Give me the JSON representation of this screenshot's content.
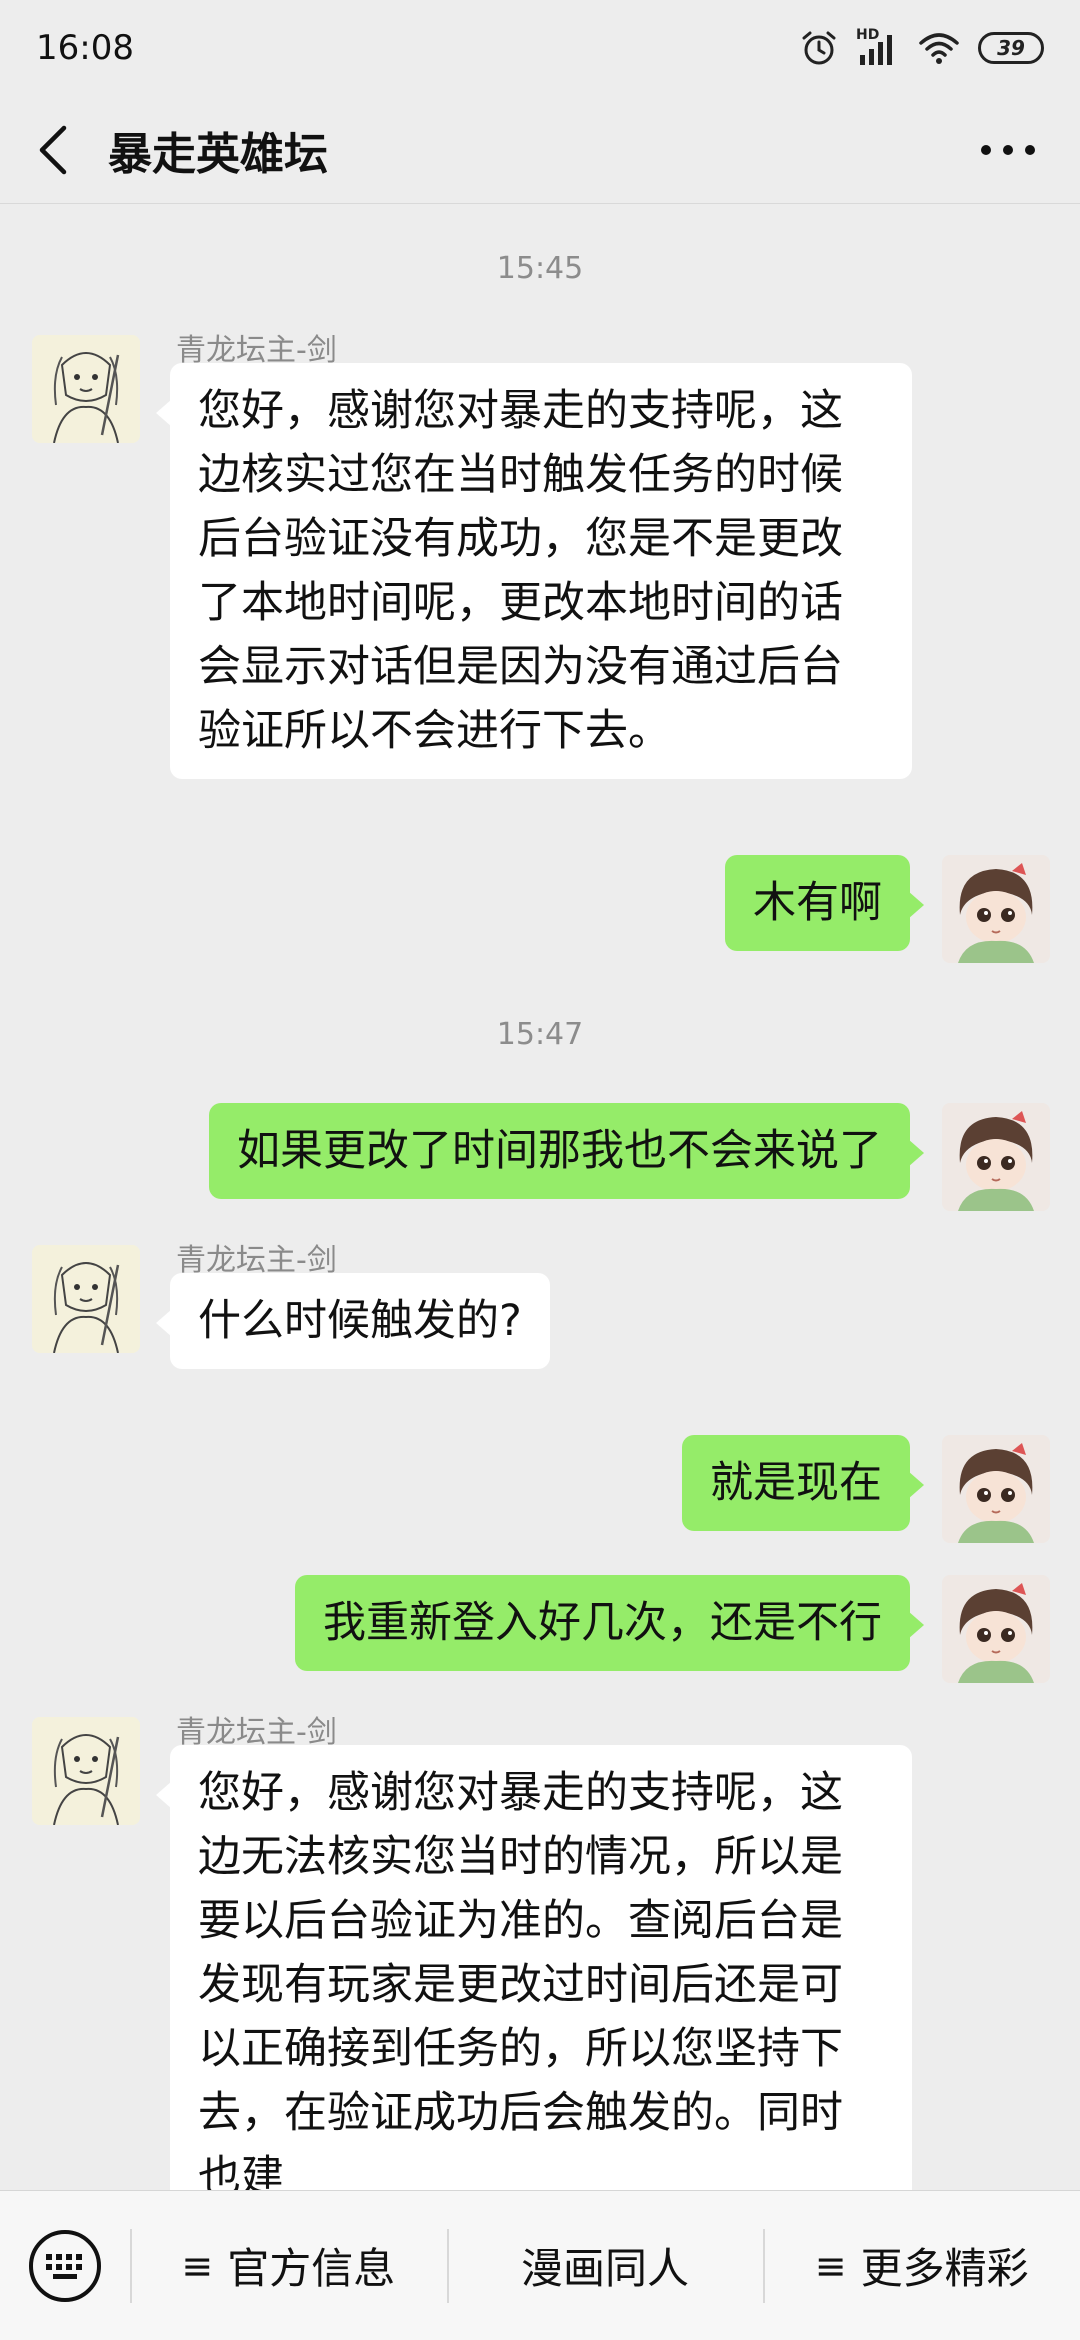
{
  "status_bar": {
    "time": "16:08",
    "network_label": "HD",
    "battery": "39"
  },
  "header": {
    "title": "暴走英雄坛"
  },
  "chat": {
    "timestamps": [
      "15:45",
      "15:47"
    ],
    "messages": [
      {
        "side": "left",
        "sender": "青龙坛主-剑",
        "text": "您好，感谢您对暴走的支持呢，这边核实过您在当时触发任务的时候后台验证没有成功，您是不是更改了本地时间呢，更改本地时间的话会显示对话但是因为没有通过后台验证所以不会进行下去。"
      },
      {
        "side": "right",
        "text": "木有啊"
      },
      {
        "side": "right",
        "text": "如果更改了时间那我也不会来说了"
      },
      {
        "side": "left",
        "sender": "青龙坛主-剑",
        "text": "什么时候触发的?"
      },
      {
        "side": "right",
        "text": "就是现在"
      },
      {
        "side": "right",
        "text": "我重新登入好几次，还是不行"
      },
      {
        "side": "left",
        "sender": "青龙坛主-剑",
        "text": "您好，感谢您对暴走的支持呢，这边无法核实您当时的情况，所以是要以后台验证为准的。查阅后台是发现有玩家是更改过时间后还是可以正确接到任务的，所以您坚持下去，在验证成功后会触发的。同时也建"
      }
    ]
  },
  "bottom_menu": {
    "items": [
      "官方信息",
      "漫画同人",
      "更多精彩"
    ],
    "menu_glyph": "≡"
  },
  "colors": {
    "background": "#ededed",
    "self_bubble": "#95ec69",
    "other_bubble": "#ffffff"
  }
}
